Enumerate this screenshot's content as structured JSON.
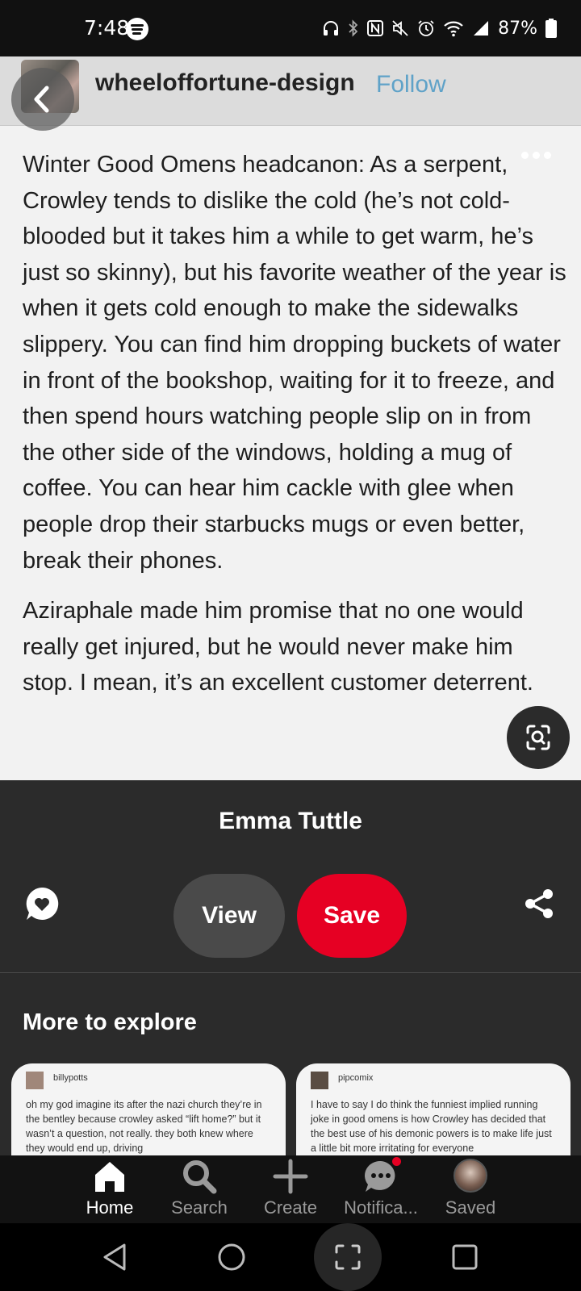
{
  "status_bar": {
    "time": "7:48",
    "battery": "87%"
  },
  "pin": {
    "username": "wheeloffortune-design",
    "follow_label": "Follow",
    "paragraphs": [
      "Winter Good Omens headcanon: As a serpent, Crowley tends to dislike the cold (he’s not cold-blooded but it takes him a while to get warm, he’s just so skinny), but his favorite weather of the year is when it gets cold enough to make the sidewalks slippery. You can find him dropping buckets of water in front of the bookshop, waiting for it to freeze, and then spend hours watching people slip on in from the other side of the windows, holding a mug of coffee. You can hear him cackle with glee when people drop their starbucks mugs or even better, break their phones.",
      "Aziraphale made him promise that no one would really get injured, but he would never make him stop. I mean, it’s an excellent customer deterrent."
    ]
  },
  "panel": {
    "title": "Emma Tuttle",
    "view_label": "View",
    "save_label": "Save",
    "explore_title": "More to explore",
    "cards": [
      {
        "user": "billypotts",
        "text": "oh my god imagine its after the nazi church they’re in the bentley because crowley asked “lift home?” but it wasn’t a question, not really. they both knew where they would end up, driving"
      },
      {
        "user": "pipcomix",
        "text": "I have to say I do think the funniest implied running joke in good omens is how Crowley has decided that the best use of his demonic powers is to make life just a little bit more irritating for everyone"
      }
    ]
  },
  "bottom_nav": {
    "items": [
      {
        "label": "Home",
        "icon": "home-icon"
      },
      {
        "label": "Search",
        "icon": "search-icon"
      },
      {
        "label": "Create",
        "icon": "plus-icon"
      },
      {
        "label": "Notifica...",
        "icon": "chat-bubble-icon"
      },
      {
        "label": "Saved",
        "icon": "avatar"
      }
    ]
  },
  "colors": {
    "save_red": "#e60023",
    "follow_blue": "#5fa2c8",
    "panel_bg": "#2b2b2b"
  }
}
